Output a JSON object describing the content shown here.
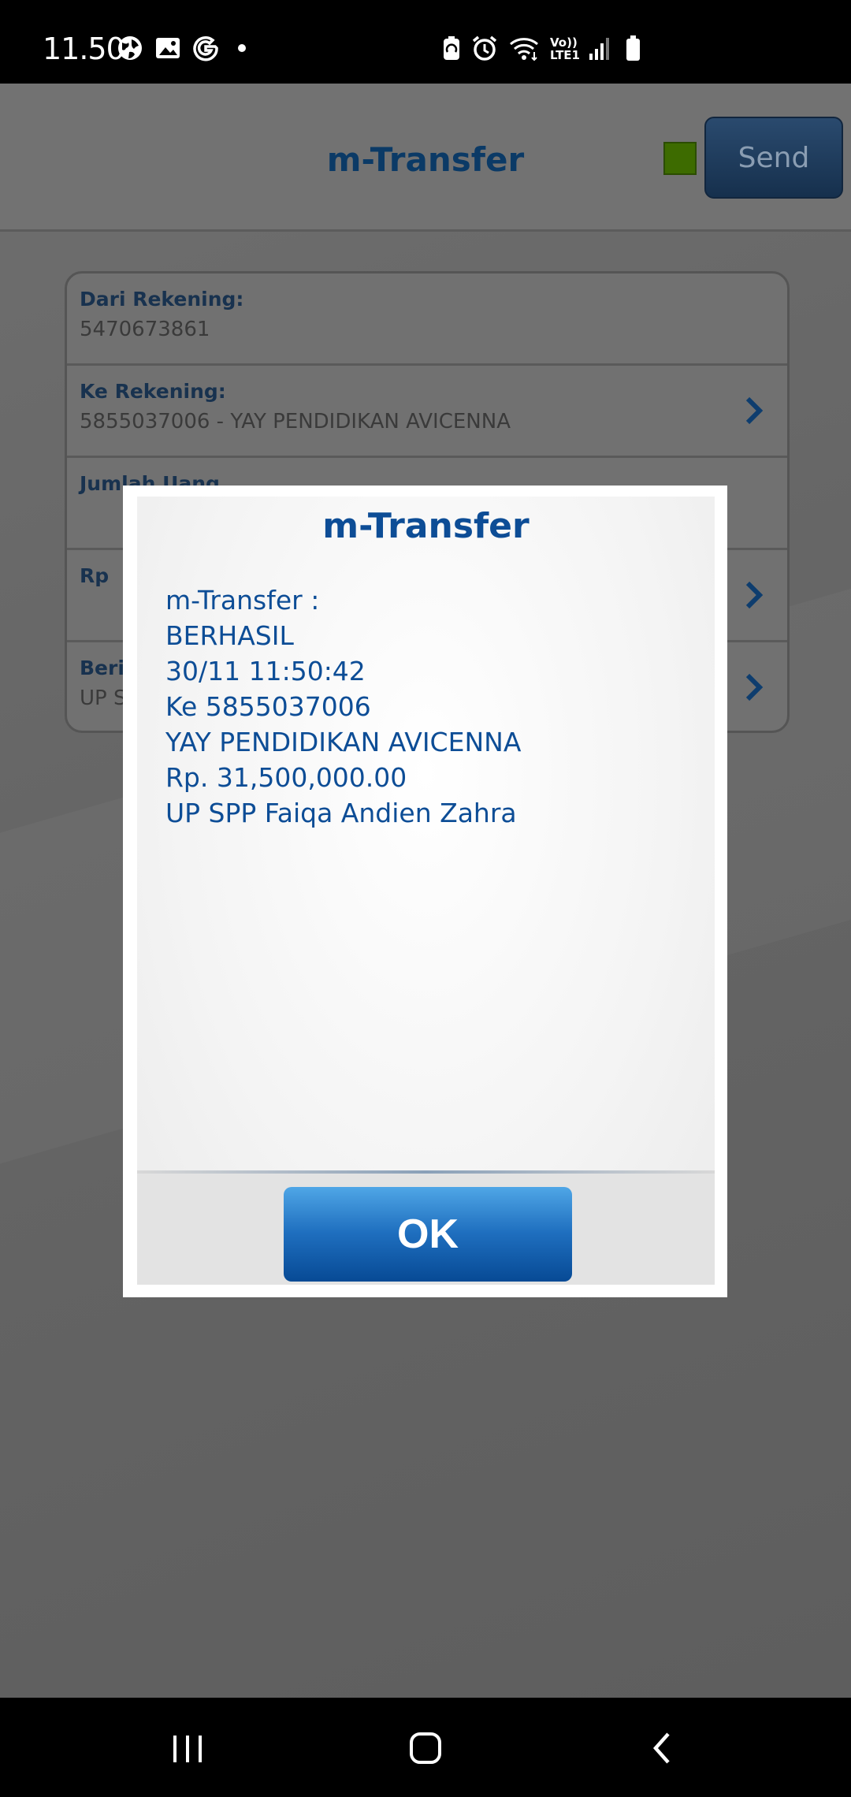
{
  "status_bar": {
    "time": "11.50",
    "network_label": "Vo)) LTE1",
    "left_icons": [
      "globe-icon",
      "gallery-icon",
      "google-icon",
      "dot-icon"
    ],
    "right_icons": [
      "battery-saver-icon",
      "alarm-icon",
      "wifi-icon",
      "volte-icon",
      "signal-icon",
      "battery-icon"
    ]
  },
  "header": {
    "title": "m-Transfer",
    "send_label": "Send",
    "indicator_color": "#3d6b00"
  },
  "form": {
    "rows": [
      {
        "label": "Dari Rekening:",
        "value": "5470673861"
      },
      {
        "label": "Ke Rekening:",
        "value": "5855037006 - YAY PENDIDIKAN AVICENNA"
      },
      {
        "label": "Jumlah Uang",
        "value": ""
      },
      {
        "label": "Rp",
        "value": ""
      },
      {
        "label": "Berita",
        "value": "UP SPP"
      }
    ]
  },
  "dialog": {
    "title": "m-Transfer",
    "lines": [
      "m-Transfer :",
      "BERHASIL",
      "30/11 11:50:42",
      "Ke 5855037006",
      "YAY PENDIDIKAN AVICENNA",
      "Rp. 31,500,000.00",
      "UP SPP Faiqa Andien Zahra"
    ],
    "ok_label": "OK",
    "accent_color": "#0d4d96"
  },
  "nav_bar": {
    "buttons": [
      "recents-icon",
      "home-icon",
      "back-icon"
    ]
  }
}
